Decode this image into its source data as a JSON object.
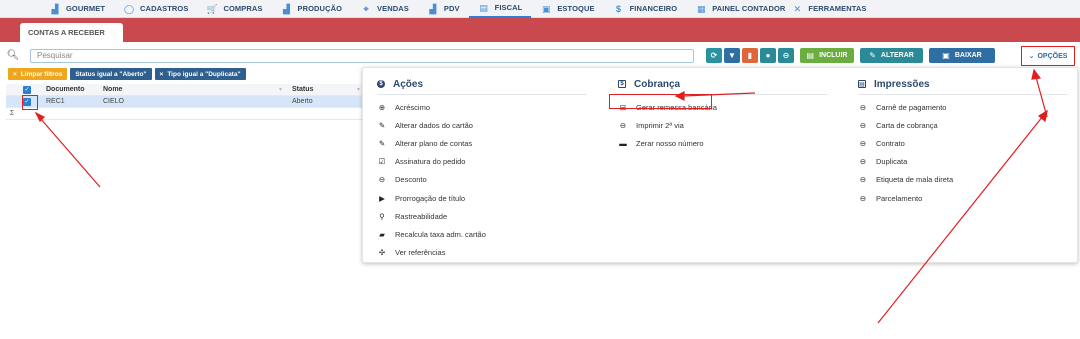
{
  "topnav": {
    "items": [
      {
        "label": "GOURMET",
        "icon": "chart-bar-icon"
      },
      {
        "label": "CADASTROS",
        "icon": "circle-outline-icon"
      },
      {
        "label": "COMPRAS",
        "icon": "shopping-cart-icon"
      },
      {
        "label": "PRODUÇÃO",
        "icon": "chart-bar-icon"
      },
      {
        "label": "VENDAS",
        "icon": "tag-icon"
      },
      {
        "label": "PDV",
        "icon": "chart-bar-icon"
      },
      {
        "label": "FISCAL",
        "icon": "document-icon"
      },
      {
        "label": "ESTOQUE",
        "icon": "box-icon"
      },
      {
        "label": "FINANCEIRO",
        "icon": "dollar-circle-icon"
      },
      {
        "label": "PAINEL CONTADOR",
        "icon": "panel-icon"
      },
      {
        "label": "FERRAMENTAS",
        "icon": "tools-icon"
      }
    ],
    "active_index": 6
  },
  "tab": {
    "label": "CONTAS A RECEBER"
  },
  "search": {
    "placeholder": "Pesquisar"
  },
  "toolbar": {
    "incluir": "INCLUIR",
    "alterar": "ALTERAR",
    "baixar": "BAIXAR",
    "opcoes": "OPÇÕES"
  },
  "filters": [
    {
      "label": "Limpar filtros",
      "style": "yellow"
    },
    {
      "label": "Status igual a \"Aberto\"",
      "style": "navy"
    },
    {
      "label": "Tipo igual a \"Duplicata\"",
      "style": "navy"
    }
  ],
  "grid": {
    "columns": [
      "Documento",
      "Nome",
      "Status"
    ],
    "rows": [
      {
        "documento": "REC1",
        "nome": "CIELO",
        "status": "Aberto"
      }
    ],
    "sum_symbol": "Σ"
  },
  "menu": {
    "acoes": {
      "title": "Ações",
      "items": [
        {
          "label": "Acréscimo",
          "icon": "plus-circle-icon"
        },
        {
          "label": "Alterar dados do cartão",
          "icon": "pencil-circle-icon"
        },
        {
          "label": "Alterar plano de contas",
          "icon": "pencil-circle-icon"
        },
        {
          "label": "Assinatura do pedido",
          "icon": "signature-icon"
        },
        {
          "label": "Desconto",
          "icon": "minus-circle-icon"
        },
        {
          "label": "Prorrogação de título",
          "icon": "forward-icon"
        },
        {
          "label": "Rastreabilidade",
          "icon": "search-icon"
        },
        {
          "label": "Recalcula taxa adm. cartão",
          "icon": "card-icon"
        },
        {
          "label": "Ver referências",
          "icon": "network-icon"
        }
      ]
    },
    "cobranca": {
      "title": "Cobrança",
      "items": [
        {
          "label": "Gerar remessa bancária",
          "icon": "bank-icon"
        },
        {
          "label": "Imprimir 2ª via",
          "icon": "print-circle-icon"
        },
        {
          "label": "Zerar nosso número",
          "icon": "folder-icon"
        }
      ]
    },
    "impressoes": {
      "title": "Impressões",
      "items": [
        {
          "label": "Carnê de pagamento",
          "icon": "print-circle-icon"
        },
        {
          "label": "Carta de cobrança",
          "icon": "print-circle-icon"
        },
        {
          "label": "Contrato",
          "icon": "print-circle-icon"
        },
        {
          "label": "Duplicata",
          "icon": "print-circle-icon"
        },
        {
          "label": "Etiqueta de mala direta",
          "icon": "print-circle-icon"
        },
        {
          "label": "Parcelamento",
          "icon": "print-circle-icon"
        }
      ]
    }
  },
  "colors": {
    "accent": "#c9494f",
    "highlight": "#e02020",
    "nav_text": "#2d4a6e"
  }
}
